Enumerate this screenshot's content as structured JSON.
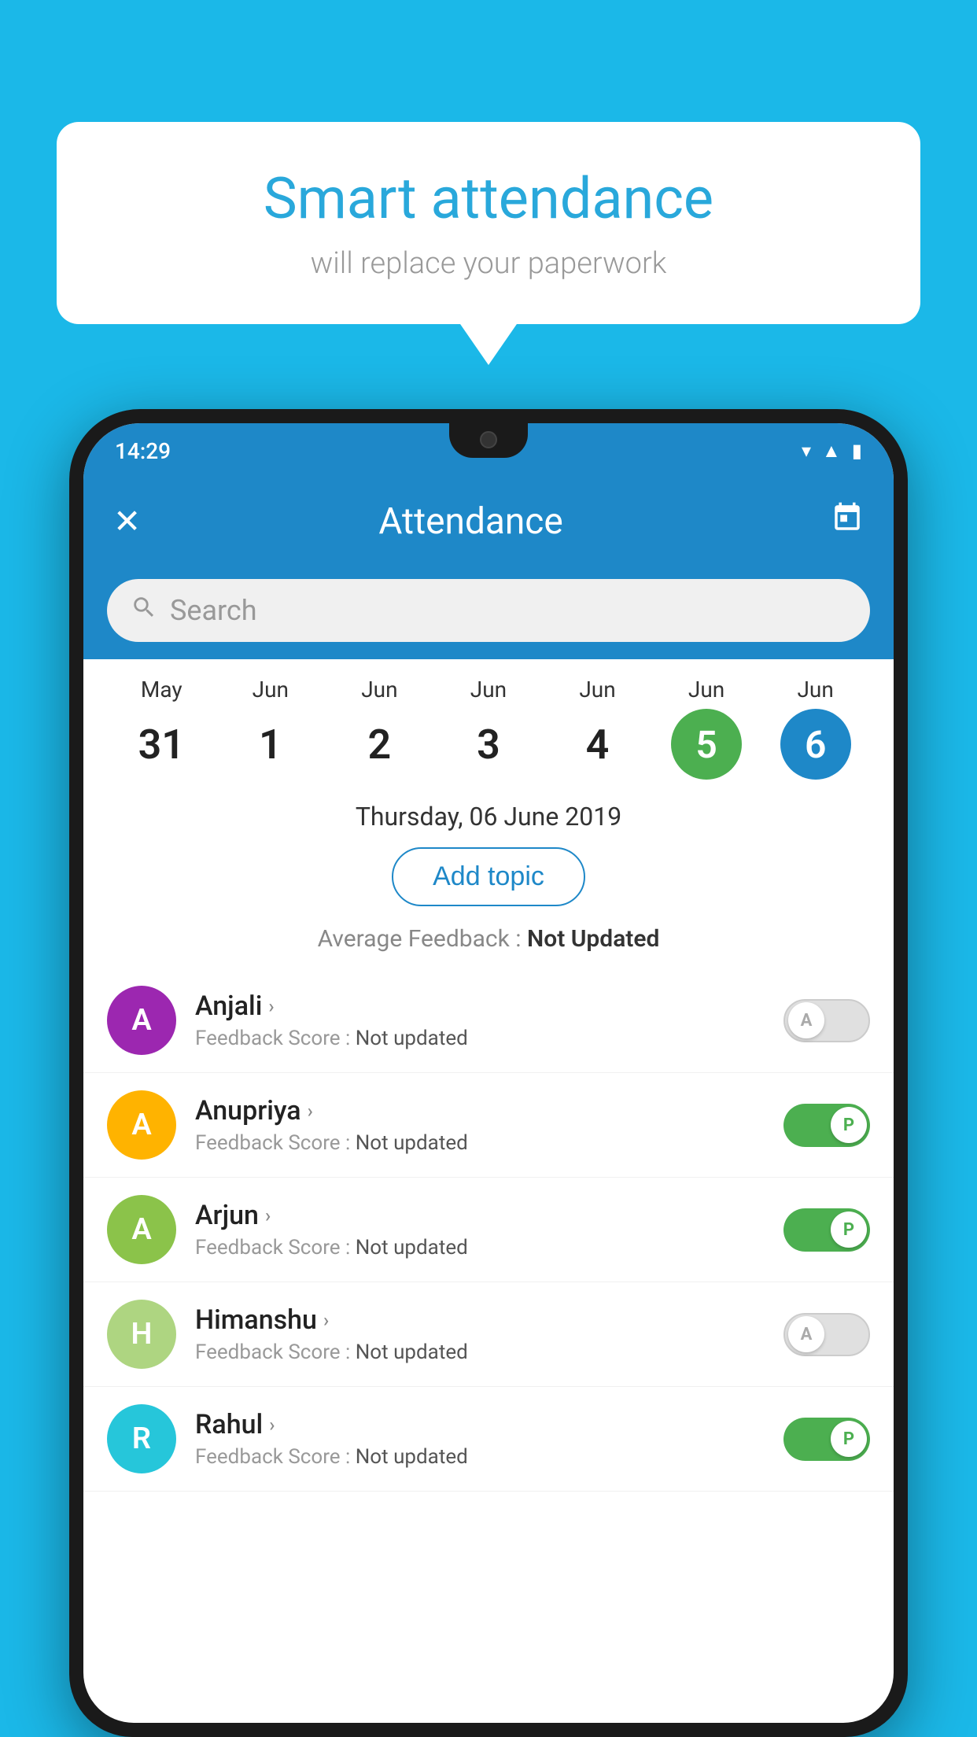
{
  "bubble": {
    "title": "Smart attendance",
    "subtitle": "will replace your paperwork"
  },
  "statusBar": {
    "time": "14:29",
    "icons": [
      "wifi",
      "signal",
      "battery"
    ]
  },
  "appBar": {
    "title": "Attendance",
    "closeIcon": "✕",
    "calendarIcon": "📅"
  },
  "search": {
    "placeholder": "Search"
  },
  "calendar": {
    "days": [
      {
        "month": "May",
        "date": "31",
        "state": "normal"
      },
      {
        "month": "Jun",
        "date": "1",
        "state": "normal"
      },
      {
        "month": "Jun",
        "date": "2",
        "state": "normal"
      },
      {
        "month": "Jun",
        "date": "3",
        "state": "normal"
      },
      {
        "month": "Jun",
        "date": "4",
        "state": "normal"
      },
      {
        "month": "Jun",
        "date": "5",
        "state": "green"
      },
      {
        "month": "Jun",
        "date": "6",
        "state": "blue"
      }
    ]
  },
  "selectedDate": "Thursday, 06 June 2019",
  "addTopicLabel": "Add topic",
  "avgFeedback": {
    "label": "Average Feedback : ",
    "value": "Not Updated"
  },
  "students": [
    {
      "name": "Anjali",
      "avatarColor": "#9c27b0",
      "avatarLetter": "A",
      "feedbackLabel": "Feedback Score : ",
      "feedbackValue": "Not updated",
      "toggleState": "off",
      "toggleLabel": "A"
    },
    {
      "name": "Anupriya",
      "avatarColor": "#ffb300",
      "avatarLetter": "A",
      "feedbackLabel": "Feedback Score : ",
      "feedbackValue": "Not updated",
      "toggleState": "on",
      "toggleLabel": "P"
    },
    {
      "name": "Arjun",
      "avatarColor": "#8bc34a",
      "avatarLetter": "A",
      "feedbackLabel": "Feedback Score : ",
      "feedbackValue": "Not updated",
      "toggleState": "on",
      "toggleLabel": "P"
    },
    {
      "name": "Himanshu",
      "avatarColor": "#aed581",
      "avatarLetter": "H",
      "feedbackLabel": "Feedback Score : ",
      "feedbackValue": "Not updated",
      "toggleState": "off",
      "toggleLabel": "A"
    },
    {
      "name": "Rahul",
      "avatarColor": "#26c6da",
      "avatarLetter": "R",
      "feedbackLabel": "Feedback Score : ",
      "feedbackValue": "Not updated",
      "toggleState": "on",
      "toggleLabel": "P"
    }
  ]
}
